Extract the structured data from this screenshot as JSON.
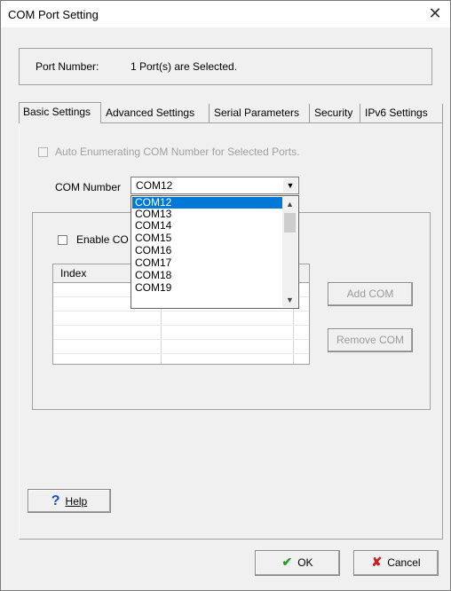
{
  "window": {
    "title": "COM Port Setting",
    "close_glyph": "✕"
  },
  "port": {
    "label": "Port Number:",
    "value": "1 Port(s) are Selected."
  },
  "tabs": [
    "Basic Settings",
    "Advanced Settings",
    "Serial Parameters",
    "Security",
    "IPv6 Settings"
  ],
  "auto_enum": {
    "label": "Auto Enumerating COM Number for Selected Ports.",
    "checked": false,
    "disabled": true
  },
  "com_number": {
    "label": "COM Number",
    "value": "COM12",
    "options": [
      "COM12",
      "COM13",
      "COM14",
      "COM15",
      "COM16",
      "COM17",
      "COM18",
      "COM19"
    ],
    "selected_index": 0
  },
  "enable": {
    "label": "Enable CO",
    "checked": false
  },
  "grid": {
    "header": "Index"
  },
  "buttons": {
    "add_com": "Add COM",
    "remove_com": "Remove COM",
    "help": "Help",
    "ok": "OK",
    "cancel": "Cancel"
  },
  "icons": {
    "close": "close-icon",
    "help": "question-icon",
    "ok": "checkmark-icon",
    "cancel": "x-icon",
    "dropdown": "chevron-down-icon"
  },
  "colors": {
    "selection": "#0078d7",
    "ok_check": "#2a9a2a",
    "cancel_x": "#c81e1e",
    "help_icon": "#1a4ec0"
  }
}
